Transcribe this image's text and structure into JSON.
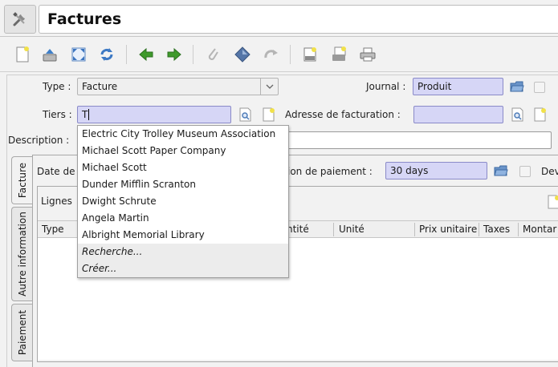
{
  "header": {
    "title": "Factures"
  },
  "form": {
    "type_label": "Type :",
    "type_value": "Facture",
    "journal_label": "Journal :",
    "journal_value": "Produit",
    "tiers_label": "Tiers :",
    "tiers_value": "T",
    "adresse_label": "Adresse de facturation :",
    "description_label": "Description :",
    "date_label_partial": "Date de",
    "condition_label_partial": "ion de paiement :",
    "condition_value": "30 days",
    "devise_label_partial": "Dev"
  },
  "tabs": [
    "Facture",
    "Autre information",
    "Paiement"
  ],
  "lines": {
    "label": "Lignes",
    "columns": [
      "Type",
      "ntité",
      "Unité",
      "Prix unitaire",
      "Taxes",
      "Montar"
    ]
  },
  "dropdown": {
    "items": [
      "Electric City Trolley Museum Association",
      "Michael Scott Paper Company",
      "Michael Scott",
      "Dunder Mifflin Scranton",
      "Dwight Schrute",
      "Angela Martin",
      "Albright Memorial Library"
    ],
    "actions": [
      "Recherche...",
      "Créer..."
    ]
  },
  "colors": {
    "required_field": "#d6d6f6",
    "accent_green": "#3f9a2c"
  }
}
